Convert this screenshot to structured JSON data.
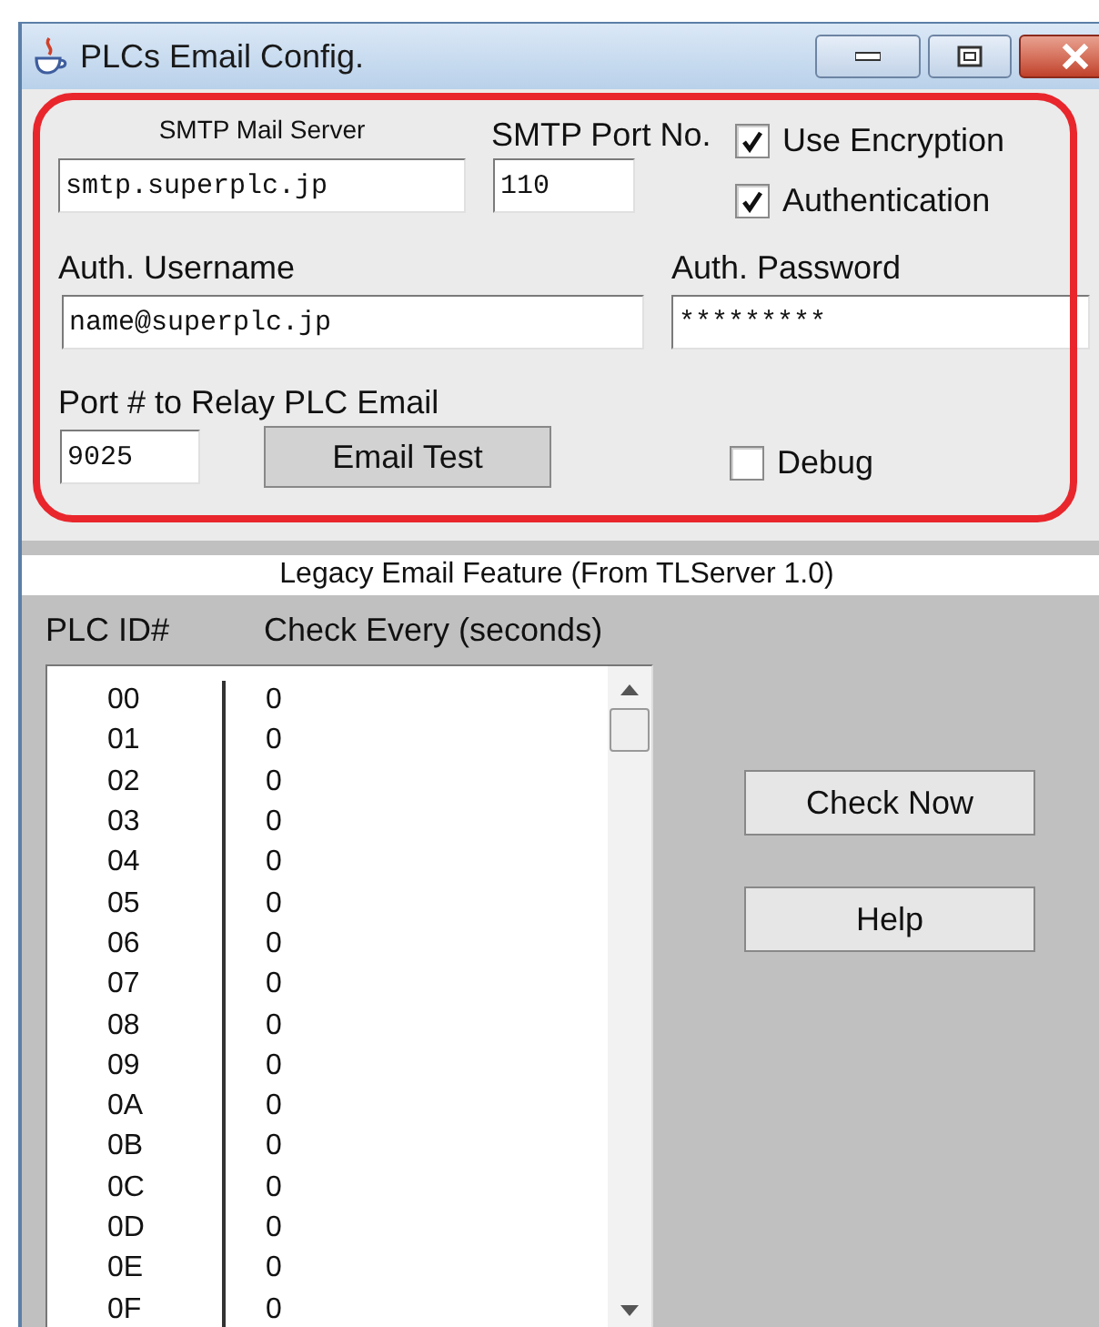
{
  "window": {
    "title": "PLCs Email Config."
  },
  "smtp": {
    "server_label": "SMTP Mail Server",
    "server_value": "smtp.superplc.jp",
    "port_label": "SMTP Port No.",
    "port_value": "110"
  },
  "options": [
    {
      "label": "Use Encryption",
      "checked": true
    },
    {
      "label": "Authentication",
      "checked": true
    }
  ],
  "auth": {
    "username_label": "Auth. Username",
    "username_value": "name@superplc.jp",
    "password_label": "Auth. Password",
    "password_value": "*********"
  },
  "relay": {
    "label": "Port # to Relay PLC Email",
    "value": "9025"
  },
  "email_test_button": "Email Test",
  "debug": {
    "label": "Debug",
    "checked": false
  },
  "legacy": {
    "title": "Legacy Email Feature (From TLServer 1.0)",
    "columns": [
      "PLC ID#",
      "Check Every (seconds)"
    ],
    "rows": [
      {
        "id": "00",
        "interval": "0"
      },
      {
        "id": "01",
        "interval": "0"
      },
      {
        "id": "02",
        "interval": "0"
      },
      {
        "id": "03",
        "interval": "0"
      },
      {
        "id": "04",
        "interval": "0"
      },
      {
        "id": "05",
        "interval": "0"
      },
      {
        "id": "06",
        "interval": "0"
      },
      {
        "id": "07",
        "interval": "0"
      },
      {
        "id": "08",
        "interval": "0"
      },
      {
        "id": "09",
        "interval": "0"
      },
      {
        "id": "0A",
        "interval": "0"
      },
      {
        "id": "0B",
        "interval": "0"
      },
      {
        "id": "0C",
        "interval": "0"
      },
      {
        "id": "0D",
        "interval": "0"
      },
      {
        "id": "0E",
        "interval": "0"
      },
      {
        "id": "0F",
        "interval": "0"
      }
    ]
  },
  "buttons": [
    "Check Now",
    "Help"
  ]
}
